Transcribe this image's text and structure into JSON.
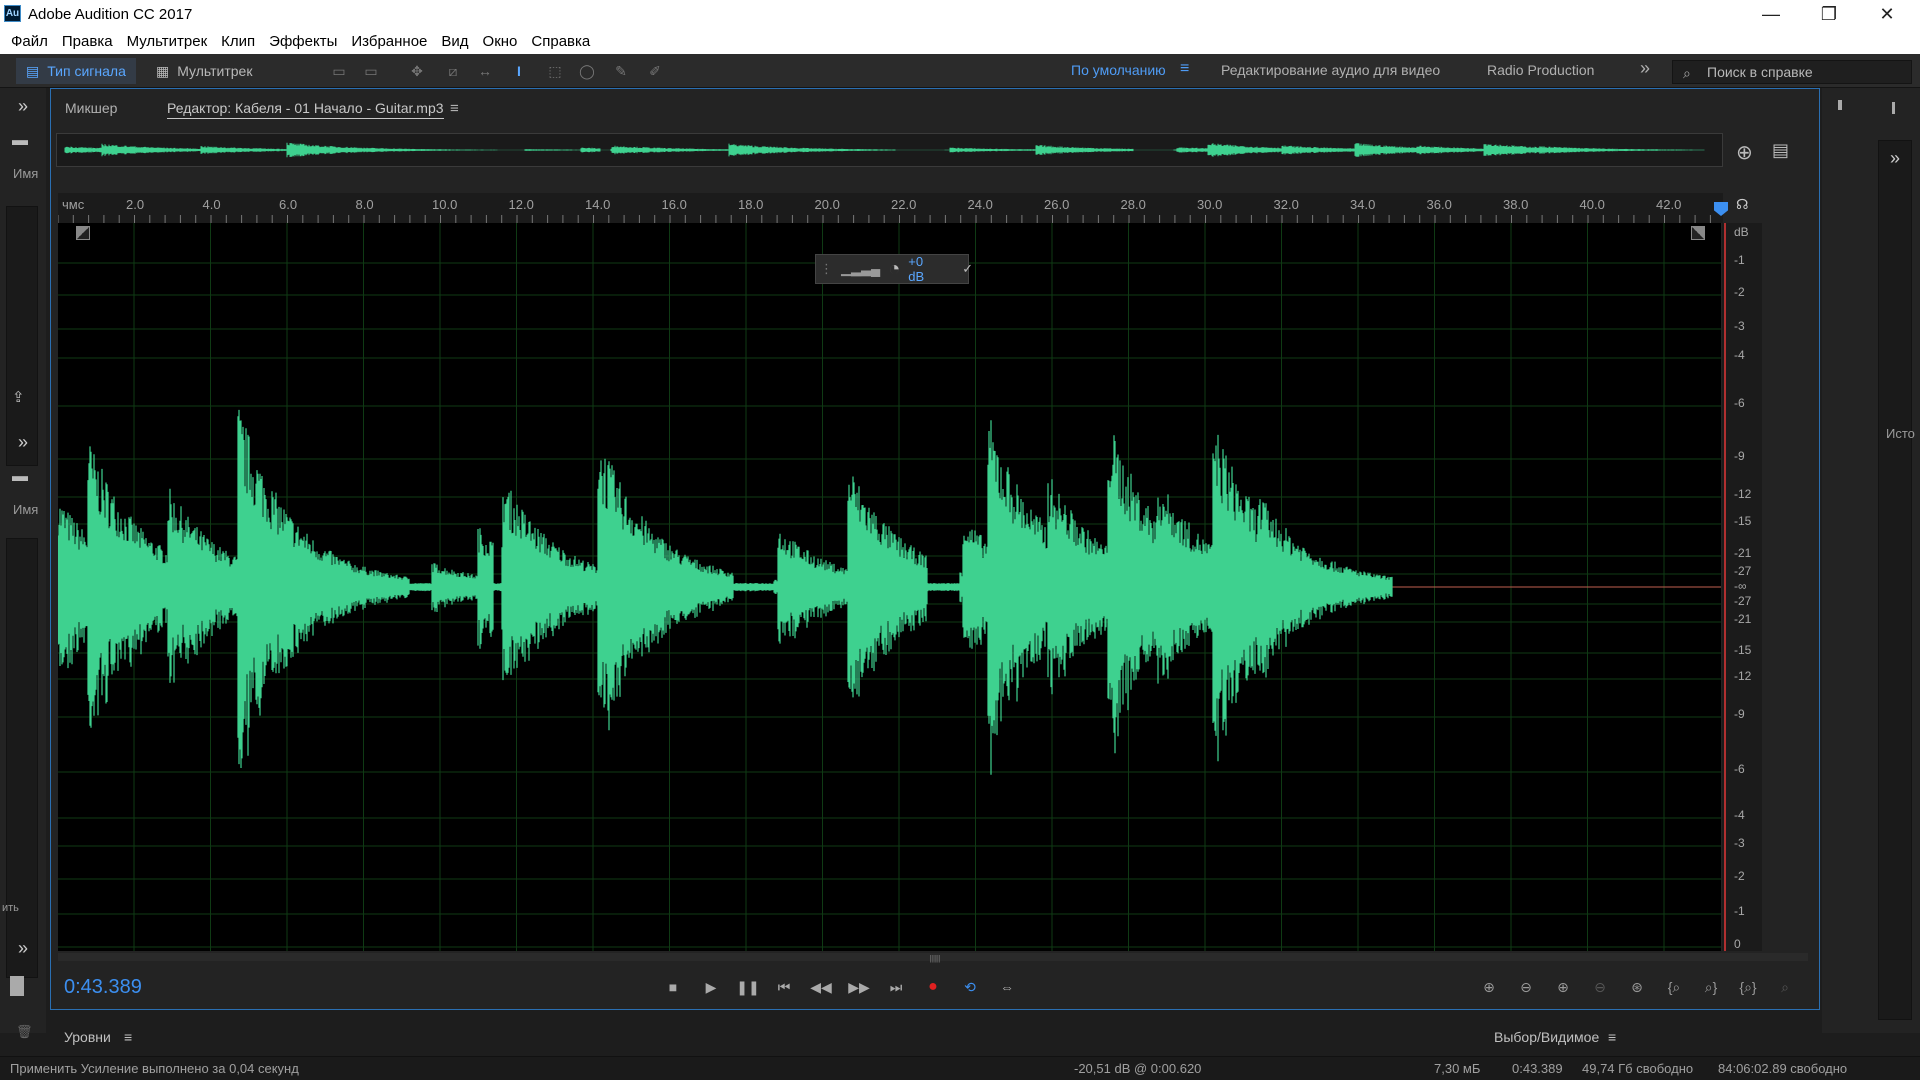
{
  "window": {
    "title": "Adobe Audition CC 2017",
    "app_icon_text": "Au",
    "minimize": "—",
    "maximize": "❐",
    "close": "✕"
  },
  "menu": [
    "Файл",
    "Правка",
    "Мультитрек",
    "Клип",
    "Эффекты",
    "Избранное",
    "Вид",
    "Окно",
    "Справка"
  ],
  "toolbar": {
    "mode_waveform": "Тип сигнала",
    "mode_multitrack": "Мультитрек",
    "workspaces": [
      "По умолчанию",
      "Редактирование аудио для видео",
      "Radio Production"
    ],
    "workspace_menu_icon": "≡",
    "more_icon": "»",
    "help_placeholder": "Поиск в справке"
  },
  "left_panel": {
    "chevron": "»",
    "name_label_1": "Имя",
    "name_label_2": "Имя",
    "truncated_label": "ить"
  },
  "editor": {
    "tab_mixer": "Микшер",
    "tab_editor": "Редактор: Кабеля - 01 Начало - Guitar.mp3",
    "tab_menu_icon": "≡",
    "ruler_unit": "чмс",
    "ruler_ticks": [
      "2.0",
      "4.0",
      "6.0",
      "8.0",
      "10.0",
      "12.0",
      "14.0",
      "16.0",
      "18.0",
      "20.0",
      "22.0",
      "24.0",
      "26.0",
      "28.0",
      "30.0",
      "32.0",
      "34.0",
      "36.0",
      "38.0",
      "40.0",
      "42.0"
    ],
    "db_label": "dB",
    "db_ticks": [
      "-1",
      "-2",
      "-3",
      "-4",
      "-6",
      "-9",
      "-12",
      "-15",
      "-21",
      "-27",
      "-∞",
      "-27",
      "-21",
      "-15",
      "-12",
      "-9",
      "-6",
      "-4",
      "-3",
      "-2",
      "-1",
      "0"
    ],
    "hud_gain": "+0 dB",
    "timecode": "0:43.389"
  },
  "bottom": {
    "levels_label": "Уровни",
    "selection_label": "Выбор/Видимое",
    "menu_icon": "≡"
  },
  "status": {
    "message": "Применить Усиление выполнено за 0,04 секунд",
    "level": "-20,51 dB @ 0:00.620",
    "size": "7,30 мБ",
    "duration": "0:43.389",
    "free_space": "49,74 Гб свободно",
    "free_time": "84:06:02.89 свободно"
  },
  "right_panel": {
    "chevron": "»",
    "label": "Исто"
  },
  "colors": {
    "waveform": "#3ed18f",
    "accent": "#3c8ff0",
    "grid": "#0f3a14",
    "record": "#e02020"
  }
}
